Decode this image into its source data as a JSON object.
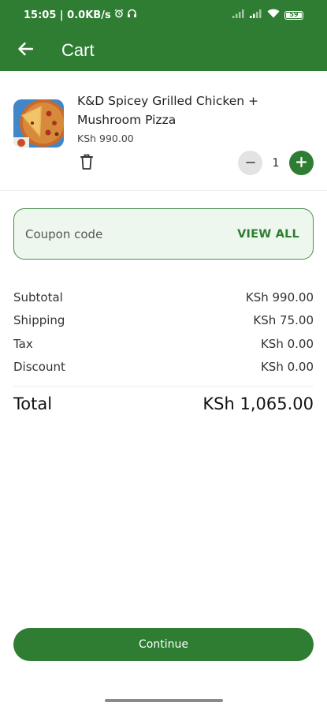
{
  "status_bar": {
    "time_speed": "15:05 | 0.0KB/s",
    "battery": "59",
    "icons": [
      "alarm-icon",
      "headset-icon",
      "signal-icon",
      "signal-icon-2",
      "wifi-icon",
      "battery-icon"
    ]
  },
  "appbar": {
    "title": "Cart",
    "back_icon": "arrow-left-icon"
  },
  "cart_item": {
    "name": "K&D Spicey Grilled Chicken + Mushroom Pizza",
    "price": "KSh 990.00",
    "quantity": "1",
    "delete_icon": "trash-icon",
    "minus_icon": "minus-icon",
    "plus_icon": "plus-icon"
  },
  "coupon": {
    "placeholder": "Coupon code",
    "view_all_label": "VIEW ALL"
  },
  "summary": {
    "rows": [
      {
        "label": "Subtotal",
        "value": "KSh 990.00"
      },
      {
        "label": "Shipping",
        "value": "KSh 75.00"
      },
      {
        "label": "Tax",
        "value": "KSh 0.00"
      },
      {
        "label": "Discount",
        "value": "KSh 0.00"
      }
    ],
    "total_label": "Total",
    "total_value": "KSh 1,065.00"
  },
  "actions": {
    "continue_label": "Continue"
  },
  "colors": {
    "primary": "#2e7d32",
    "coupon_bg": "#eef7ee"
  }
}
